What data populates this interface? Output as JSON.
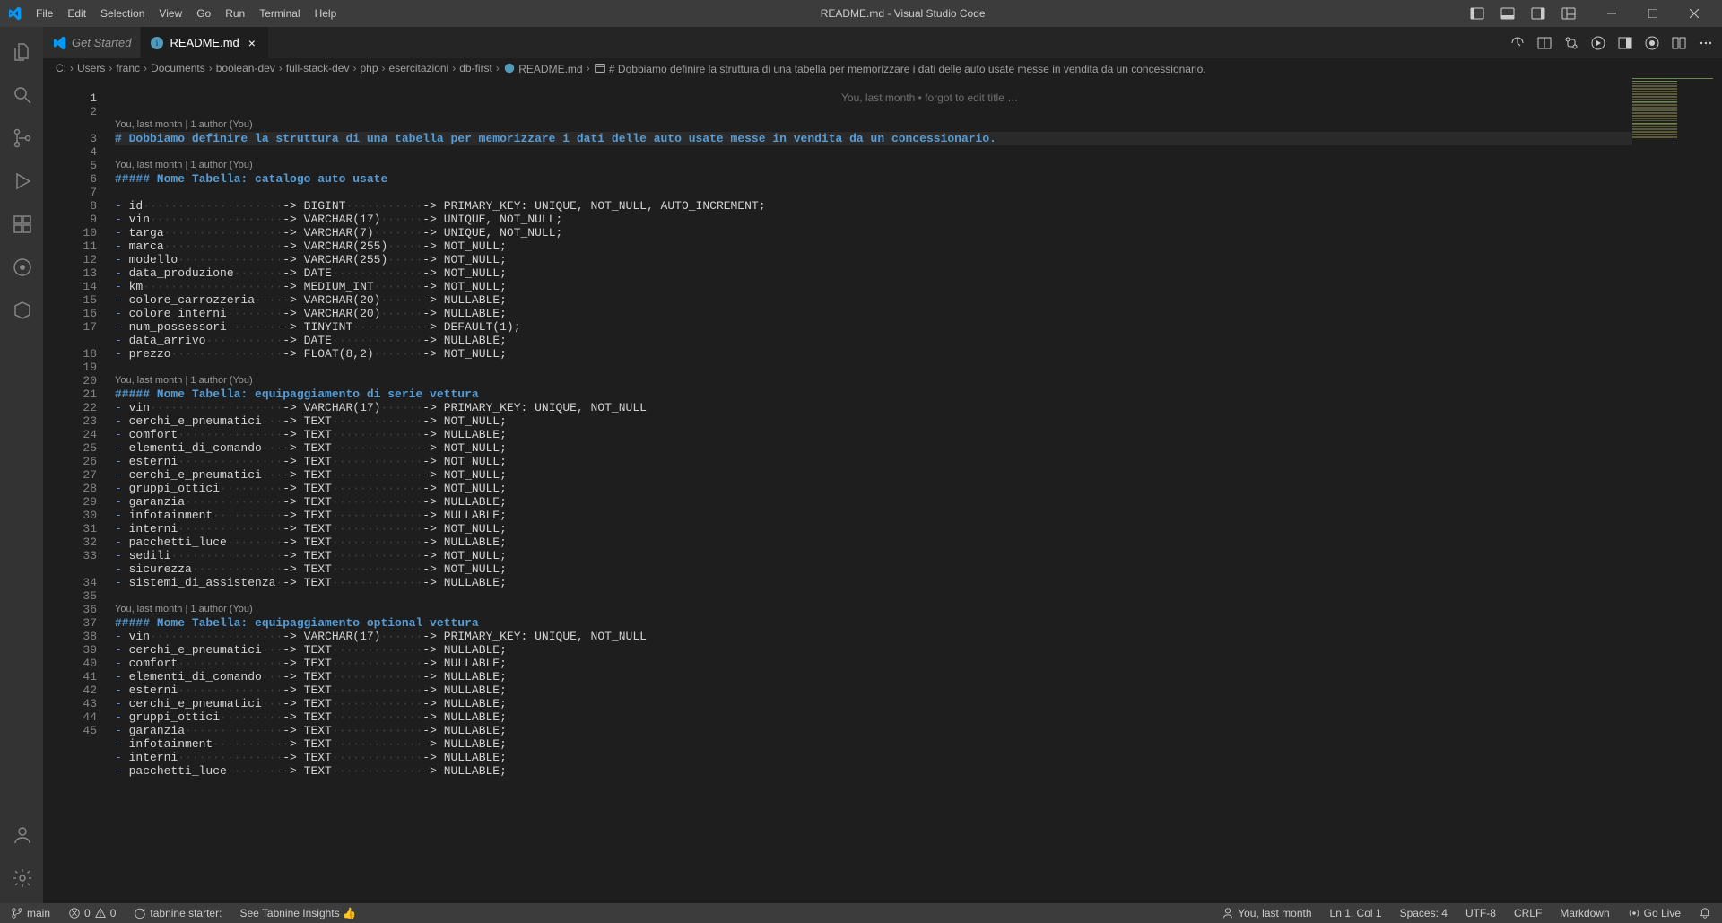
{
  "title": "README.md - Visual Studio Code",
  "menu": [
    "File",
    "Edit",
    "Selection",
    "View",
    "Go",
    "Run",
    "Terminal",
    "Help"
  ],
  "tabs": [
    {
      "label": "Get Started",
      "active": false,
      "italic": true
    },
    {
      "label": "README.md",
      "active": true,
      "italic": false
    }
  ],
  "breadcrumbs": [
    "C:",
    "Users",
    "franc",
    "Documents",
    "boolean-dev",
    "full-stack-dev",
    "php",
    "esercitazioni",
    "db-first",
    "README.md",
    "# Dobbiamo definire la struttura di una tabella per memorizzare i dati delle auto usate messe in vendita da un concessionario."
  ],
  "codelens": "You, last month | 1 author (You)",
  "inline_blame": "You, last month • forgot to edit title …",
  "code": [
    {
      "n": 1,
      "type": "h1",
      "text": "# Dobbiamo definire la struttura di una tabella per memorizzare i dati delle auto usate messe in vendita da un concessionario."
    },
    {
      "n": 2,
      "type": "blank",
      "text": ""
    },
    {
      "n": null,
      "type": "codelens"
    },
    {
      "n": 3,
      "type": "h5",
      "text": "##### Nome Tabella: catalogo auto usate"
    },
    {
      "n": 4,
      "type": "blank",
      "text": ""
    },
    {
      "n": 5,
      "type": "li",
      "name": "id",
      "t1": "BIGINT",
      "t2": "PRIMARY_KEY: UNIQUE, NOT_NULL, AUTO_INCREMENT;"
    },
    {
      "n": 6,
      "type": "li",
      "name": "vin",
      "t1": "VARCHAR(17)",
      "t2": "UNIQUE, NOT_NULL;"
    },
    {
      "n": 7,
      "type": "li",
      "name": "targa",
      "t1": "VARCHAR(7)",
      "t2": "UNIQUE, NOT_NULL;"
    },
    {
      "n": 8,
      "type": "li",
      "name": "marca",
      "t1": "VARCHAR(255)",
      "t2": "NOT_NULL;"
    },
    {
      "n": 9,
      "type": "li",
      "name": "modello",
      "t1": "VARCHAR(255)",
      "t2": "NOT_NULL;"
    },
    {
      "n": 10,
      "type": "li",
      "name": "data_produzione",
      "t1": "DATE",
      "t2": "NOT_NULL;"
    },
    {
      "n": 11,
      "type": "li",
      "name": "km",
      "t1": "MEDIUM_INT",
      "t2": "NOT_NULL;"
    },
    {
      "n": 12,
      "type": "li",
      "name": "colore_carrozzeria",
      "t1": "VARCHAR(20)",
      "t2": "NULLABLE;"
    },
    {
      "n": 13,
      "type": "li",
      "name": "colore_interni",
      "t1": "VARCHAR(20)",
      "t2": "NULLABLE;"
    },
    {
      "n": 14,
      "type": "li",
      "name": "num_possessori",
      "t1": "TINYINT",
      "t2": "DEFAULT(1);"
    },
    {
      "n": 15,
      "type": "li",
      "name": "data_arrivo",
      "t1": "DATE",
      "t2": "NULLABLE;"
    },
    {
      "n": 16,
      "type": "li",
      "name": "prezzo",
      "t1": "FLOAT(8,2)",
      "t2": "NOT_NULL;"
    },
    {
      "n": 17,
      "type": "blank",
      "text": ""
    },
    {
      "n": null,
      "type": "codelens"
    },
    {
      "n": 18,
      "type": "h5",
      "text": "##### Nome Tabella: equipaggiamento di serie vettura"
    },
    {
      "n": 19,
      "type": "li",
      "name": "vin",
      "t1": "VARCHAR(17)",
      "t2": "PRIMARY_KEY: UNIQUE, NOT_NULL"
    },
    {
      "n": 20,
      "type": "li",
      "name": "cerchi_e_pneumatici",
      "t1": "TEXT",
      "t2": "NOT_NULL;"
    },
    {
      "n": 21,
      "type": "li",
      "name": "comfort",
      "t1": "TEXT",
      "t2": "NULLABLE;"
    },
    {
      "n": 22,
      "type": "li",
      "name": "elementi_di_comando",
      "t1": "TEXT",
      "t2": "NOT_NULL;"
    },
    {
      "n": 23,
      "type": "li",
      "name": "esterni",
      "t1": "TEXT",
      "t2": "NOT_NULL;"
    },
    {
      "n": 24,
      "type": "li",
      "name": "cerchi_e_pneumatici",
      "t1": "TEXT",
      "t2": "NOT_NULL;"
    },
    {
      "n": 25,
      "type": "li",
      "name": "gruppi_ottici",
      "t1": "TEXT",
      "t2": "NOT_NULL;"
    },
    {
      "n": 26,
      "type": "li",
      "name": "garanzia",
      "t1": "TEXT",
      "t2": "NULLABLE;"
    },
    {
      "n": 27,
      "type": "li",
      "name": "infotainment",
      "t1": "TEXT",
      "t2": "NULLABLE;"
    },
    {
      "n": 28,
      "type": "li",
      "name": "interni",
      "t1": "TEXT",
      "t2": "NOT_NULL;"
    },
    {
      "n": 29,
      "type": "li",
      "name": "pacchetti_luce",
      "t1": "TEXT",
      "t2": "NULLABLE;"
    },
    {
      "n": 30,
      "type": "li",
      "name": "sedili",
      "t1": "TEXT",
      "t2": "NOT_NULL;"
    },
    {
      "n": 31,
      "type": "li",
      "name": "sicurezza",
      "t1": "TEXT",
      "t2": "NOT_NULL;"
    },
    {
      "n": 32,
      "type": "li",
      "name": "sistemi_di_assistenza",
      "t1": "TEXT",
      "t2": "NULLABLE;",
      "col1w": 22
    },
    {
      "n": 33,
      "type": "blank",
      "text": ""
    },
    {
      "n": null,
      "type": "codelens"
    },
    {
      "n": 34,
      "type": "h5",
      "text": "##### Nome Tabella: equipaggiamento optional vettura"
    },
    {
      "n": 35,
      "type": "li",
      "name": "vin",
      "t1": "VARCHAR(17)",
      "t2": "PRIMARY_KEY: UNIQUE, NOT_NULL"
    },
    {
      "n": 36,
      "type": "li",
      "name": "cerchi_e_pneumatici",
      "t1": "TEXT",
      "t2": "NULLABLE;"
    },
    {
      "n": 37,
      "type": "li",
      "name": "comfort",
      "t1": "TEXT",
      "t2": "NULLABLE;"
    },
    {
      "n": 38,
      "type": "li",
      "name": "elementi_di_comando",
      "t1": "TEXT",
      "t2": "NULLABLE;"
    },
    {
      "n": 39,
      "type": "li",
      "name": "esterni",
      "t1": "TEXT",
      "t2": "NULLABLE;"
    },
    {
      "n": 40,
      "type": "li",
      "name": "cerchi_e_pneumatici",
      "t1": "TEXT",
      "t2": "NULLABLE;"
    },
    {
      "n": 41,
      "type": "li",
      "name": "gruppi_ottici",
      "t1": "TEXT",
      "t2": "NULLABLE;"
    },
    {
      "n": 42,
      "type": "li",
      "name": "garanzia",
      "t1": "TEXT",
      "t2": "NULLABLE;"
    },
    {
      "n": 43,
      "type": "li",
      "name": "infotainment",
      "t1": "TEXT",
      "t2": "NULLABLE;"
    },
    {
      "n": 44,
      "type": "li",
      "name": "interni",
      "t1": "TEXT",
      "t2": "NULLABLE;"
    },
    {
      "n": 45,
      "type": "li",
      "name": "pacchetti_luce",
      "t1": "TEXT",
      "t2": "NULLABLE;"
    }
  ],
  "status": {
    "branch": "main",
    "errors": "0",
    "warnings": "0",
    "tabnine_starter": "tabnine starter:",
    "tabnine_insights": "See Tabnine Insights 👍",
    "blame": "You, last month",
    "cursor": "Ln 1, Col 1",
    "spaces": "Spaces: 4",
    "encoding": "UTF-8",
    "eol": "CRLF",
    "lang": "Markdown",
    "golive": "Go Live"
  }
}
